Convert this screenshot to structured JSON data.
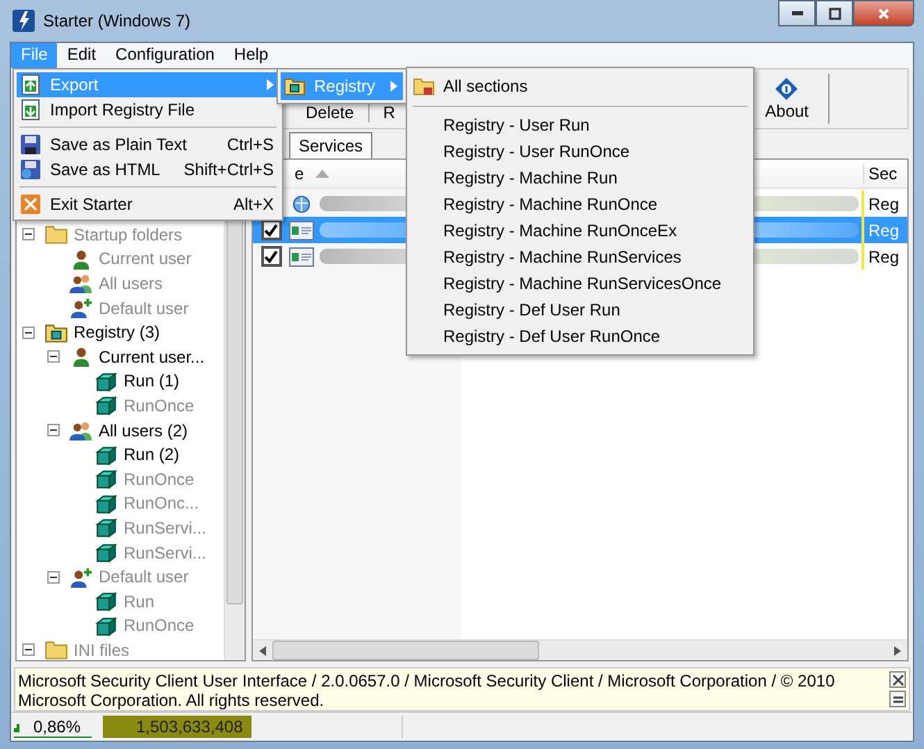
{
  "window": {
    "title": "Starter (Windows 7)"
  },
  "menu_bar": [
    {
      "label": "File",
      "selected": true
    },
    {
      "label": "Edit",
      "selected": false
    },
    {
      "label": "Configuration",
      "selected": false
    },
    {
      "label": "Help",
      "selected": false
    }
  ],
  "file_menu": [
    {
      "kind": "item",
      "label": "Export",
      "submenu": true,
      "selected": true
    },
    {
      "kind": "item",
      "label": "Import Registry File",
      "submenu": false,
      "selected": false
    },
    {
      "kind": "separator"
    },
    {
      "kind": "item",
      "label": "Save as Plain Text",
      "shortcut": "Ctrl+S",
      "submenu": false,
      "selected": false
    },
    {
      "kind": "item",
      "label": "Save as HTML",
      "shortcut": "Shift+Ctrl+S",
      "submenu": false,
      "selected": false
    },
    {
      "kind": "separator"
    },
    {
      "kind": "item",
      "label": "Exit Starter",
      "shortcut": "Alt+X",
      "submenu": false,
      "selected": false
    }
  ],
  "export_submenu": [
    {
      "label": "Registry",
      "selected": true
    }
  ],
  "registry_submenu": [
    {
      "kind": "header",
      "label": "All sections"
    },
    {
      "kind": "separator"
    },
    {
      "kind": "item",
      "label": "Registry - User Run"
    },
    {
      "kind": "item",
      "label": "Registry - User RunOnce"
    },
    {
      "kind": "item",
      "label": "Registry - Machine Run"
    },
    {
      "kind": "item",
      "label": "Registry - Machine RunOnce"
    },
    {
      "kind": "item",
      "label": "Registry - Machine RunOnceEx"
    },
    {
      "kind": "item",
      "label": "Registry - Machine RunServices"
    },
    {
      "kind": "item",
      "label": "Registry - Machine RunServicesOnce"
    },
    {
      "kind": "item",
      "label": "Registry - Def User Run"
    },
    {
      "kind": "item",
      "label": "Registry - Def User RunOnce"
    }
  ],
  "toolbar": {
    "buttons": [
      "Delete",
      "R"
    ],
    "about": "About"
  },
  "tabs": [
    {
      "label": "Services",
      "selected": true
    }
  ],
  "tree": [
    {
      "label": "Startup folders",
      "kind": "folder",
      "active": false,
      "expanded": true,
      "children": [
        {
          "label": "Current user",
          "kind": "user",
          "active": false
        },
        {
          "label": "All users",
          "kind": "users",
          "active": false
        },
        {
          "label": "Default user",
          "kind": "default-user",
          "active": false
        }
      ]
    },
    {
      "label": "Registry (3)",
      "kind": "registry",
      "active": true,
      "expanded": true,
      "children": [
        {
          "label": "Current user...",
          "kind": "user",
          "active": true,
          "expanded": true,
          "children": [
            {
              "label": "Run (1)",
              "kind": "key",
              "active": true
            },
            {
              "label": "RunOnce",
              "kind": "key",
              "active": false
            }
          ]
        },
        {
          "label": "All users (2)",
          "kind": "users",
          "active": true,
          "expanded": true,
          "children": [
            {
              "label": "Run (2)",
              "kind": "key",
              "active": true
            },
            {
              "label": "RunOnce",
              "kind": "key",
              "active": false
            },
            {
              "label": "RunOnc...",
              "kind": "key",
              "active": false
            },
            {
              "label": "RunServi...",
              "kind": "key",
              "active": false
            },
            {
              "label": "RunServi...",
              "kind": "key",
              "active": false
            }
          ]
        },
        {
          "label": "Default user",
          "kind": "default-user",
          "active": false,
          "expanded": true,
          "children": [
            {
              "label": "Run",
              "kind": "key",
              "active": false
            },
            {
              "label": "RunOnce",
              "kind": "key",
              "active": false
            }
          ]
        }
      ]
    },
    {
      "label": "INI files",
      "kind": "folder",
      "active": false,
      "expanded": true
    }
  ],
  "list": {
    "columns": [
      {
        "label": "e",
        "sorted": true
      },
      {
        "label": "Sec",
        "sorted": false
      }
    ],
    "rows": [
      {
        "kind": "service",
        "selected": false,
        "section": "Reg"
      },
      {
        "kind": "window",
        "selected": true,
        "checked": true,
        "section": "Reg"
      },
      {
        "kind": "window",
        "selected": false,
        "checked": true,
        "section": "Reg"
      }
    ]
  },
  "info": {
    "text": "Microsoft Security Client User Interface / 2.0.0657.0 / Microsoft Security Client / Microsoft Corporation / © 2010 Microsoft Corporation. All rights reserved."
  },
  "status_bar": {
    "cpu": "0,86%",
    "memory": "1,503,633,408"
  }
}
